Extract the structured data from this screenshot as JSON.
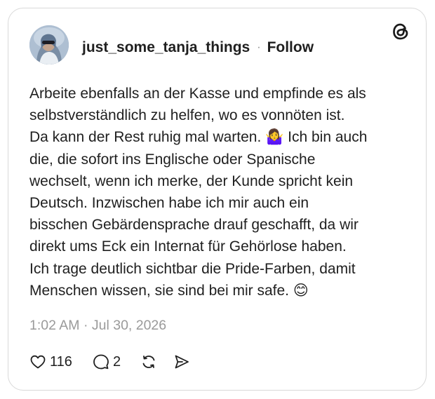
{
  "post": {
    "username": "just_some_tanja_things",
    "separator": "·",
    "follow_label": "Follow",
    "lines": [
      "Arbeite ebenfalls an der Kasse und empfinde es als",
      "selbstverständlich zu helfen, wo es vonnöten ist.",
      "Da kann der Rest ruhig mal warten. 🤷‍♀️ Ich bin auch",
      "die, die sofort ins Englische oder Spanische",
      "wechselt, wenn ich merke, der Kunde spricht kein",
      "Deutsch. Inzwischen habe ich mir auch ein",
      "bisschen Gebärdensprache drauf geschafft, da wir",
      "direkt ums Eck ein Internat für Gehörlose haben.",
      "Ich trage deutlich sichtbar die Pride-Farben, damit",
      "Menschen wissen, sie sind bei mir safe. 😊"
    ],
    "timestamp": "1:02 AM · Jul 30, 2026"
  },
  "actions": {
    "like_count": "116",
    "reply_count": "2"
  },
  "icons": {
    "logo": "threads-logo-icon",
    "like": "heart-icon",
    "reply": "comment-icon",
    "repost": "repost-icon",
    "share": "send-icon"
  }
}
